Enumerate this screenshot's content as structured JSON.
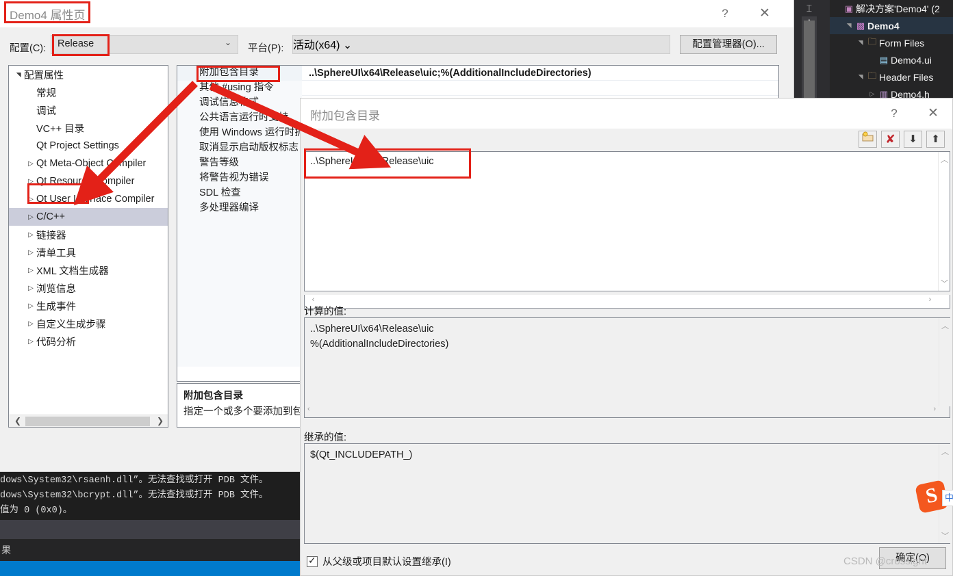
{
  "colors": {
    "annotation_red": "#e32118",
    "accent_blue": "#007acc",
    "selection": "#cbcddb"
  },
  "property_pages_dialog": {
    "title": "Demo4 属性页",
    "help_glyph": "?",
    "close_glyph": "✕",
    "configuration_label": "配置(C):",
    "configuration_value": "Release",
    "platform_label": "平台(P):",
    "platform_value": "活动(x64)",
    "config_manager_button": "配置管理器(O)...",
    "tree": {
      "items": [
        {
          "label": "配置属性",
          "indent": 0,
          "twisty": "expanded",
          "selected": false
        },
        {
          "label": "常规",
          "indent": 1,
          "twisty": "none",
          "selected": false
        },
        {
          "label": "调试",
          "indent": 1,
          "twisty": "none",
          "selected": false
        },
        {
          "label": "VC++ 目录",
          "indent": 1,
          "twisty": "none",
          "selected": false
        },
        {
          "label": "Qt Project Settings",
          "indent": 1,
          "twisty": "none",
          "selected": false
        },
        {
          "label": "Qt Meta-Object Compiler",
          "indent": 1,
          "twisty": "collapsed",
          "selected": false
        },
        {
          "label": "Qt Resource Compiler",
          "indent": 1,
          "twisty": "collapsed",
          "selected": false
        },
        {
          "label": "Qt User Interface Compiler",
          "indent": 1,
          "twisty": "collapsed",
          "selected": false
        },
        {
          "label": "C/C++",
          "indent": 1,
          "twisty": "collapsed",
          "selected": true
        },
        {
          "label": "链接器",
          "indent": 1,
          "twisty": "collapsed",
          "selected": false
        },
        {
          "label": "清单工具",
          "indent": 1,
          "twisty": "collapsed",
          "selected": false
        },
        {
          "label": "XML 文档生成器",
          "indent": 1,
          "twisty": "collapsed",
          "selected": false
        },
        {
          "label": "浏览信息",
          "indent": 1,
          "twisty": "collapsed",
          "selected": false
        },
        {
          "label": "生成事件",
          "indent": 1,
          "twisty": "collapsed",
          "selected": false
        },
        {
          "label": "自定义生成步骤",
          "indent": 1,
          "twisty": "collapsed",
          "selected": false
        },
        {
          "label": "代码分析",
          "indent": 1,
          "twisty": "collapsed",
          "selected": false
        }
      ]
    },
    "property_grid": {
      "rows": [
        {
          "name": "附加包含目录",
          "value": "..\\SphereUI\\x64\\Release\\uic;%(AdditionalIncludeDirectories)"
        },
        {
          "name": "其他 #using 指令",
          "value": ""
        },
        {
          "name": "调试信息格式",
          "value": ""
        },
        {
          "name": "公共语言运行时支持",
          "value": ""
        },
        {
          "name": "使用 Windows 运行时扩展",
          "value": ""
        },
        {
          "name": "取消显示启动版权标志",
          "value": ""
        },
        {
          "name": "警告等级",
          "value": ""
        },
        {
          "name": "将警告视为错误",
          "value": ""
        },
        {
          "name": "SDL 检查",
          "value": ""
        },
        {
          "name": "多处理器编译",
          "value": ""
        }
      ]
    },
    "description": {
      "title": "附加包含目录",
      "body": "指定一个或多个要添加到包含路径的目录; 使用分号分隔。"
    }
  },
  "include_dirs_dialog": {
    "title": "附加包含目录",
    "help_glyph": "?",
    "close_glyph": "✕",
    "toolbar": [
      {
        "name": "new-folder-icon",
        "glyph": "🗀"
      },
      {
        "name": "delete-icon",
        "glyph": "✘"
      },
      {
        "name": "move-down-icon",
        "glyph": "⬇"
      },
      {
        "name": "move-up-icon",
        "glyph": "⬆"
      }
    ],
    "entries": [
      "..\\SphereUI\\x64\\Release\\uic"
    ],
    "evaluated_label": "计算的值:",
    "evaluated_value": "..\\SphereUI\\x64\\Release\\uic\n%(AdditionalIncludeDirectories)",
    "inherited_label": "继承的值:",
    "inherited_value": "$(Qt_INCLUDEPATH_)",
    "inherit_checkbox_label": "从父级或项目默认设置继承(I)",
    "inherit_checked": true,
    "ok_button": "确定(O)"
  },
  "solution_explorer": {
    "rows": [
      {
        "label": "解决方案'Demo4' (2",
        "indent": 0,
        "twisty": "",
        "icon": "solution-icon",
        "bold": false
      },
      {
        "label": "Demo4",
        "indent": 1,
        "twisty": "▲",
        "icon": "project-icon",
        "bold": true
      },
      {
        "label": "Form Files",
        "indent": 2,
        "twisty": "▲",
        "icon": "folder-icon",
        "bold": false
      },
      {
        "label": "Demo4.ui",
        "indent": 3,
        "twisty": "",
        "icon": "ui-file-icon",
        "bold": false
      },
      {
        "label": "Header Files",
        "indent": 2,
        "twisty": "▲",
        "icon": "folder-icon",
        "bold": false
      },
      {
        "label": "Demo4.h",
        "indent": 3,
        "twisty": "▷",
        "icon": "header-file-icon",
        "bold": false
      }
    ]
  },
  "output_window": {
    "lines": [
      "dows\\System32\\rsaenh.dll”。无法查找或打开 PDB 文件。",
      "dows\\System32\\bcrypt.dll”。无法查找或打开 PDB 文件。",
      "值为 0 (0x0)。"
    ],
    "tab_label": "果"
  },
  "watermark": {
    "text": "CSDN @crossight"
  },
  "sogou_ime": {
    "logo": "S",
    "tip": "中"
  }
}
